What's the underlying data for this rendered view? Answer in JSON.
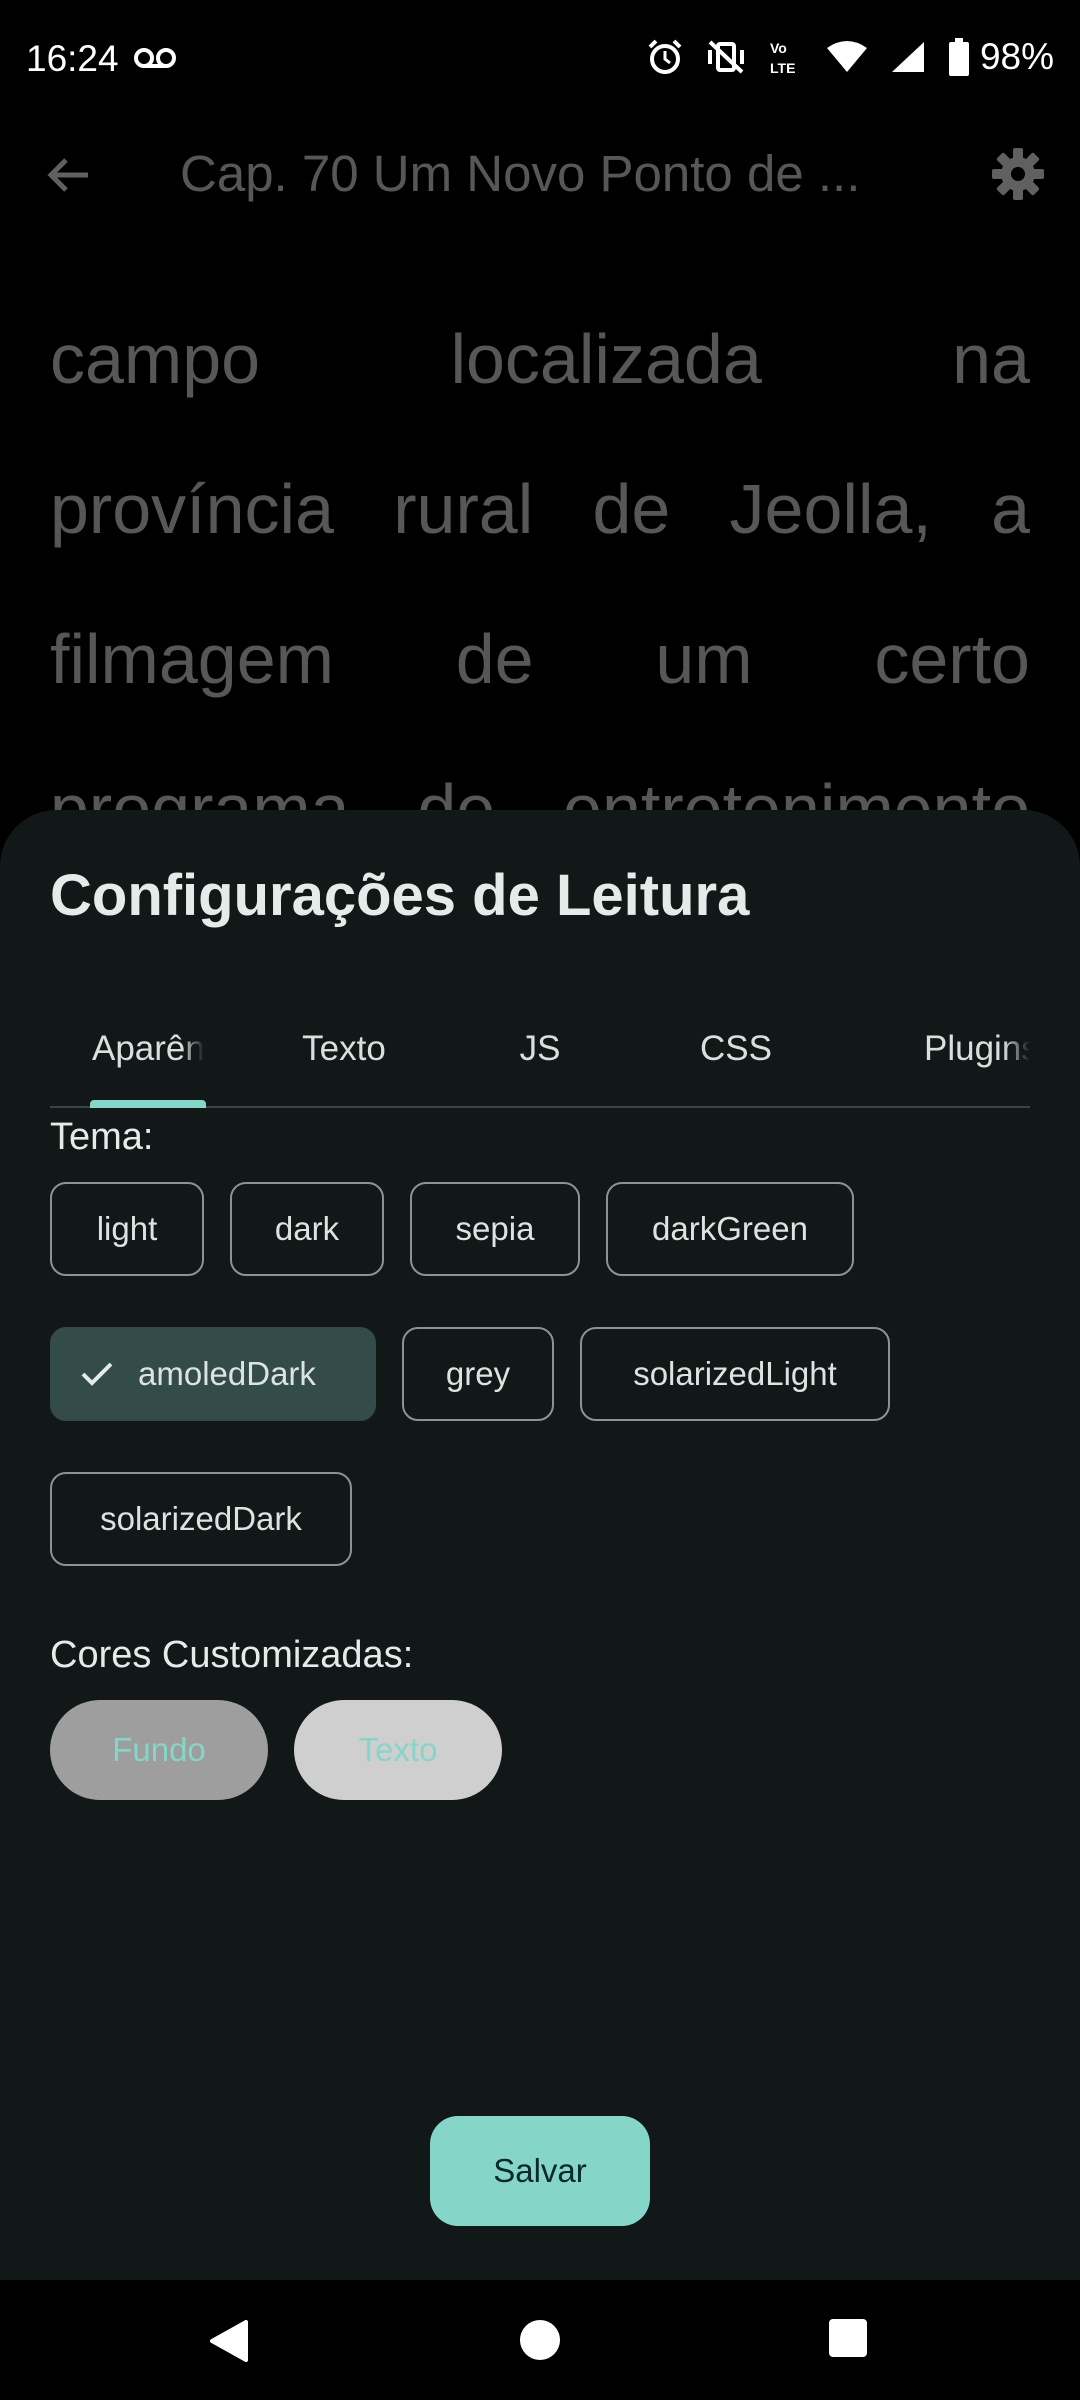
{
  "status_bar": {
    "time": "16:24",
    "battery": "98%",
    "icons": [
      "voicemail-icon",
      "alarm-icon",
      "vibrate-off-icon",
      "volte-icon",
      "wifi-icon",
      "signal-icon",
      "battery-icon"
    ]
  },
  "app_bar": {
    "title": "Cap. 70 Um Novo Ponto de ...",
    "back_icon": "arrow-left-icon",
    "settings_icon": "gear-icon"
  },
  "reader": {
    "lines": [
      [
        "campo",
        "localizada",
        "na"
      ],
      [
        "província",
        "rural",
        "de",
        "Jeolla,",
        "a"
      ],
      [
        "filmagem",
        "de",
        "um",
        "certo"
      ],
      [
        "programa",
        "de",
        "entretenimento"
      ]
    ]
  },
  "sheet": {
    "title": "Configurações de Leitura",
    "tabs": [
      "Aparência",
      "Texto",
      "JS",
      "CSS",
      "Plugins"
    ],
    "active_tab": "Aparência",
    "theme_label": "Tema:",
    "themes": [
      "light",
      "dark",
      "sepia",
      "darkGreen",
      "amoledDark",
      "grey",
      "solarizedLight",
      "solarizedDark"
    ],
    "selected_theme": "amoledDark",
    "custom_colors_label": "Cores Customizadas:",
    "background_button": "Fundo",
    "text_button": "Texto",
    "save_button": "Salvar"
  },
  "colors": {
    "accent": "#85d6c9",
    "sheet_background": "#121717",
    "selected_chip": "#334b49",
    "background_swatch": "#9e9e9e",
    "text_swatch": "#cfcfcf"
  }
}
